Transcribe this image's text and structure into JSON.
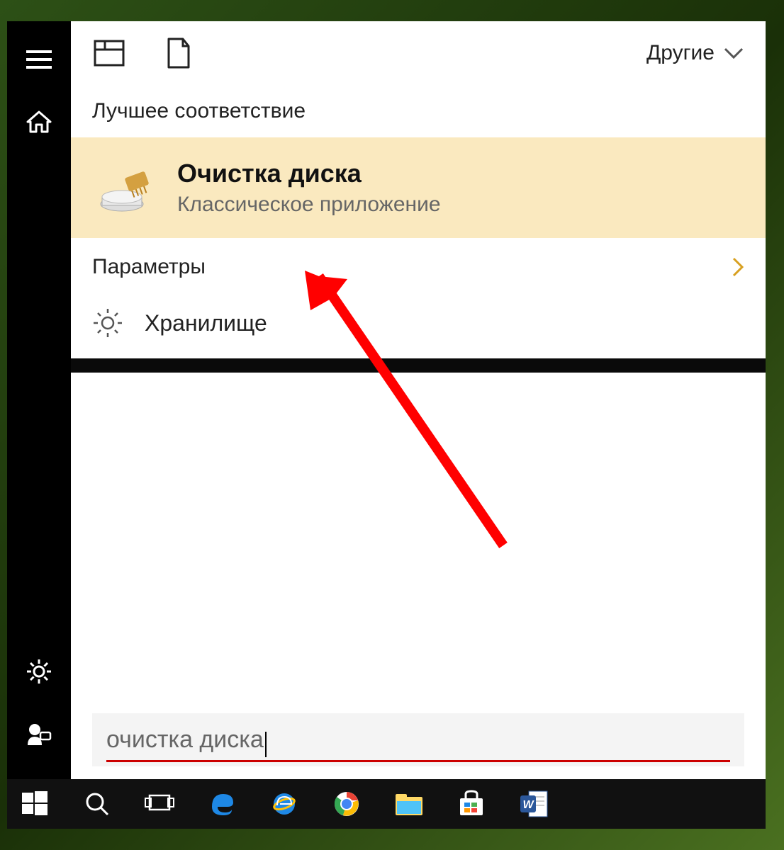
{
  "top": {
    "other_label": "Другие"
  },
  "sections": {
    "best_match_label": "Лучшее соответствие",
    "settings_label": "Параметры"
  },
  "best_match": {
    "title": "Очистка диска",
    "subtitle": "Классическое приложение"
  },
  "settings_items": [
    {
      "icon": "gear",
      "label": "Хранилище"
    }
  ],
  "search": {
    "value": "очистка диска"
  },
  "sidebar_icons": [
    "menu",
    "home",
    "gear",
    "feedback"
  ],
  "taskbar_icons": [
    "start",
    "search",
    "taskview",
    "edge",
    "ie",
    "chrome",
    "explorer",
    "store",
    "word"
  ],
  "colors": {
    "highlight": "#fae9bf",
    "accent": "#d8a020",
    "annotation": "#ff0000"
  }
}
